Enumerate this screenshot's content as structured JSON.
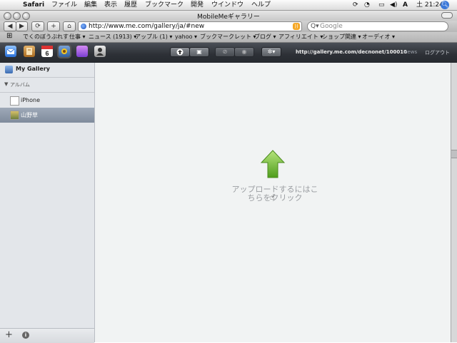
{
  "menubar": {
    "app": "Safari",
    "items": [
      "ファイル",
      "編集",
      "表示",
      "履歴",
      "ブックマーク",
      "開発",
      "ウインドウ",
      "ヘルプ"
    ],
    "clock": "土 21:24"
  },
  "window": {
    "title": "MobileMeギャラリー"
  },
  "toolbar": {
    "back": "◀",
    "forward": "▶",
    "reload": "⟳",
    "add": "+",
    "home": "⌂",
    "url": "http://www.me.com/gallery/ja/#new",
    "search_placeholder": "Google"
  },
  "bookmarks": [
    "でくのぼうぶれす",
    "仕事 ▾",
    "ニュース (1913) ▾",
    "アップル (1) ▾",
    "yahoo ▾",
    "ブックマークレット ▾",
    "ブログ ▾",
    "アフィリエイト ▾",
    "ショップ関連 ▾",
    "オーディオ ▾"
  ],
  "appbar": {
    "gallery_url": "http://gallery.me.com/decnonet/100010",
    "news": "news",
    "logout": "ログアウト",
    "calendar_day": "6"
  },
  "sidebar": {
    "my_gallery": "My Gallery",
    "albums_header": "アルバム",
    "albums": [
      {
        "label": "iPhone",
        "selected": false
      },
      {
        "label": "山野草",
        "selected": true
      }
    ],
    "add": "+",
    "info": "i"
  },
  "main": {
    "upload_line1": "アップロードするにはこ",
    "upload_line2": "ちらをクリック"
  },
  "colors": {
    "appbar": "#2d3036",
    "selection": "#8692a3",
    "upload_arrow": "#6dbd2b"
  }
}
